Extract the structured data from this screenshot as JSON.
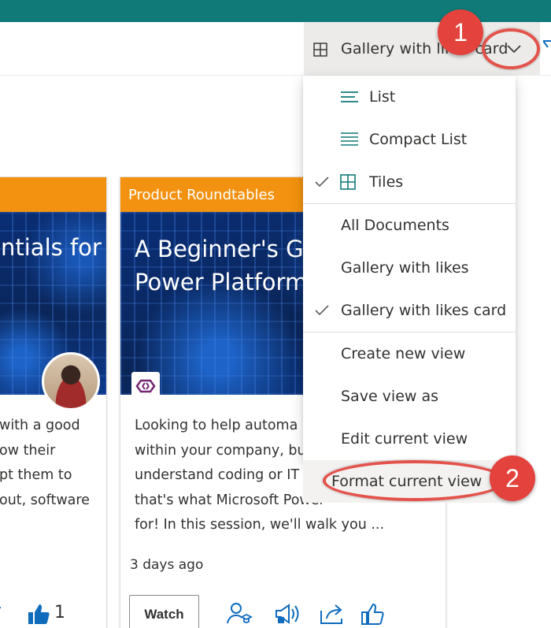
{
  "toolbar": {
    "view_label": "Gallery with likes card",
    "icons": [
      "grid-view-icon",
      "chevron-down-icon",
      "filter-icon"
    ]
  },
  "menu": {
    "layout_items": [
      {
        "label": "List",
        "icon": "list-icon",
        "checked": false
      },
      {
        "label": "Compact List",
        "icon": "compact-list-icon",
        "checked": false
      },
      {
        "label": "Tiles",
        "icon": "tiles-icon",
        "checked": true
      }
    ],
    "view_items": [
      {
        "label": "All Documents",
        "checked": false
      },
      {
        "label": "Gallery with likes",
        "checked": false
      },
      {
        "label": "Gallery with likes card",
        "checked": true
      }
    ],
    "action_items": [
      {
        "label": "Create new view"
      },
      {
        "label": "Save view as"
      },
      {
        "label": "Edit current view"
      },
      {
        "label": "Format current view"
      }
    ]
  },
  "cards": {
    "left": {
      "thumb_title": "ntials for",
      "body": [
        "with a good",
        "ow their",
        "pt them to",
        "out, software"
      ],
      "like_count": "1"
    },
    "mid": {
      "category": "Product Roundtables",
      "thumb_title_lines": [
        "A Beginner's Gu",
        "Power Platform"
      ],
      "body": [
        "Looking to help automa",
        "within your company, bu",
        "understand coding or IT",
        "that's what Microsoft Power",
        "for! In this session, we'll walk you ..."
      ],
      "posted": "3 days ago",
      "watch_label": "Watch"
    }
  },
  "annotations": {
    "step1": "1",
    "step2": "2",
    "color": "#e3433c"
  },
  "colors": {
    "topbar": "#0f7a78",
    "card_header": "#f39210",
    "accent_blue": "#0f6cbd"
  }
}
